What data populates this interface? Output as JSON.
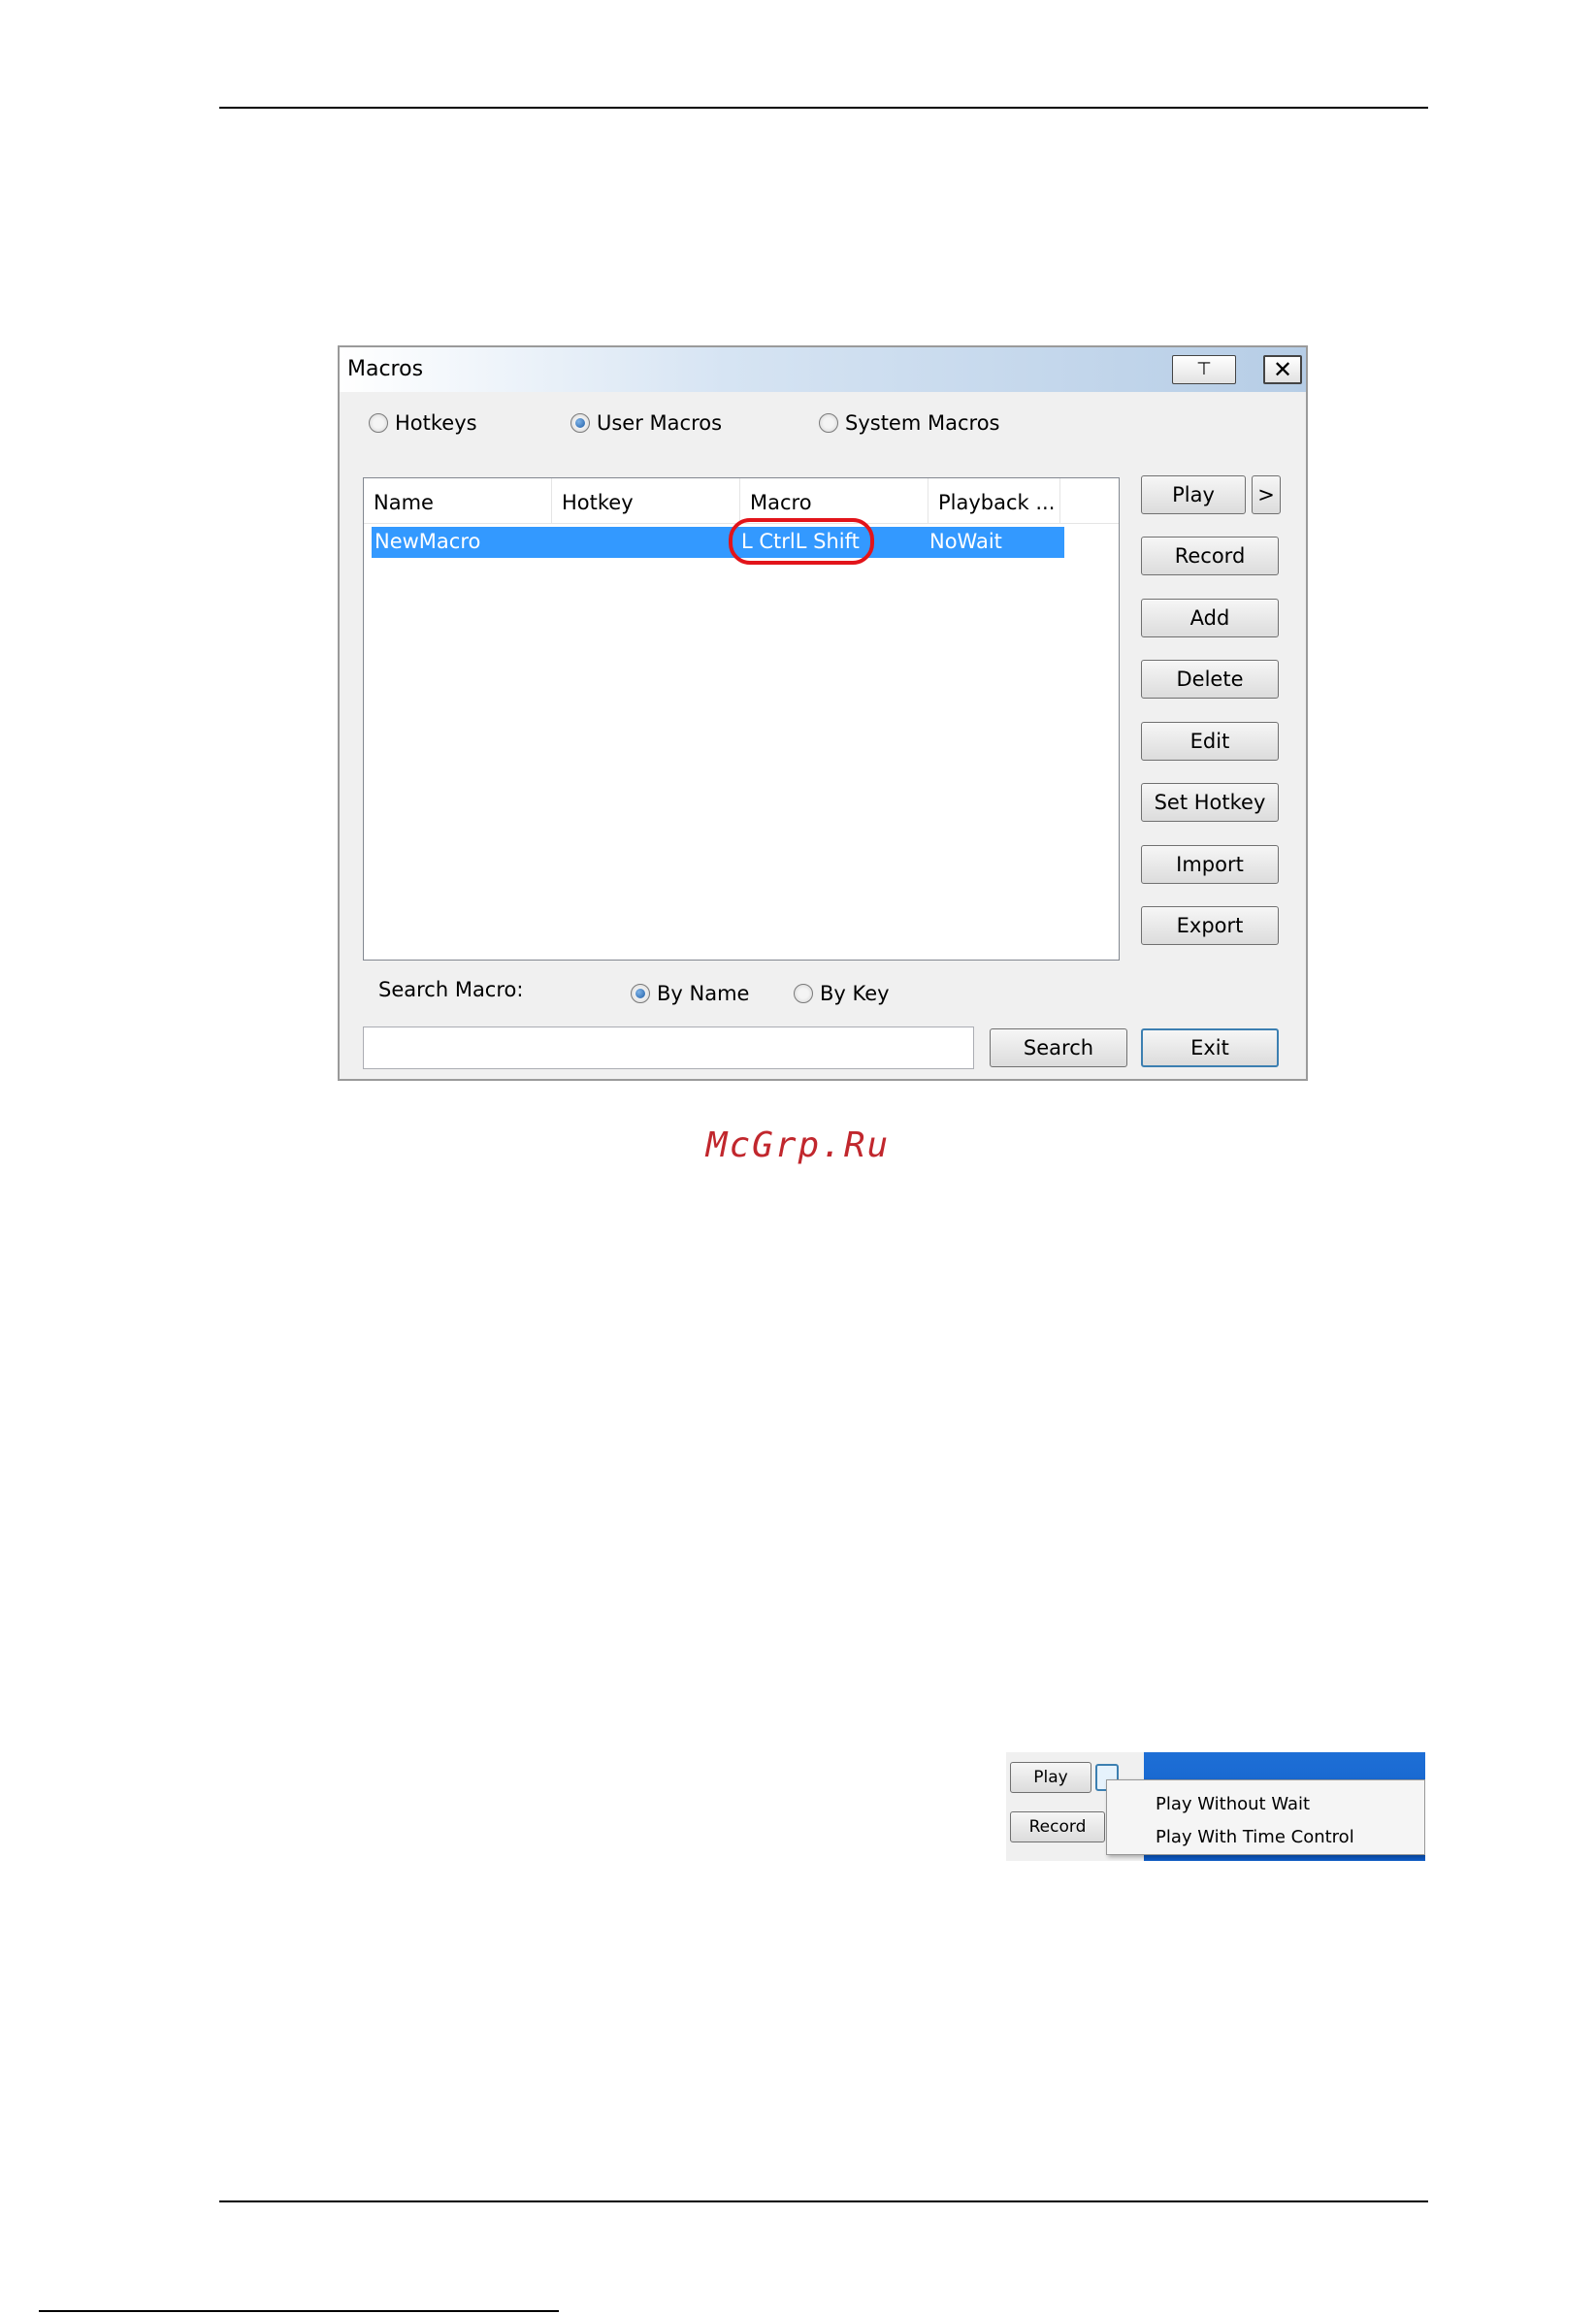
{
  "dialog": {
    "title": "Macros",
    "pin_label": "⊤",
    "close_label": "✕",
    "mode_options": [
      {
        "label": "Hotkeys",
        "selected": false
      },
      {
        "label": "User Macros",
        "selected": true
      },
      {
        "label": "System Macros",
        "selected": false
      }
    ],
    "columns": [
      "Name",
      "Hotkey",
      "Macro",
      "Playback ..."
    ],
    "rows": [
      {
        "name": "NewMacro",
        "hotkey": "",
        "macro": "L CtrlL Shift",
        "playback": "NoWait",
        "selected": true
      }
    ],
    "buttons": {
      "play": "Play",
      "play_more": ">",
      "record": "Record",
      "add": "Add",
      "delete": "Delete",
      "edit": "Edit",
      "set_hotkey": "Set Hotkey",
      "import": "Import",
      "export": "Export",
      "search": "Search",
      "exit": "Exit"
    },
    "search": {
      "label": "Search Macro:",
      "by_name": "By Name",
      "by_key": "By Key",
      "selected": "By Name",
      "value": "",
      "placeholder": ""
    },
    "highlight_color": "#e2141a",
    "selection_color": "#3399ff"
  },
  "watermark": "McGrp.Ru",
  "play_menu_example": {
    "play_label": "Play",
    "record_label": "Record",
    "items": [
      "Play Without Wait",
      "Play With Time Control"
    ]
  }
}
